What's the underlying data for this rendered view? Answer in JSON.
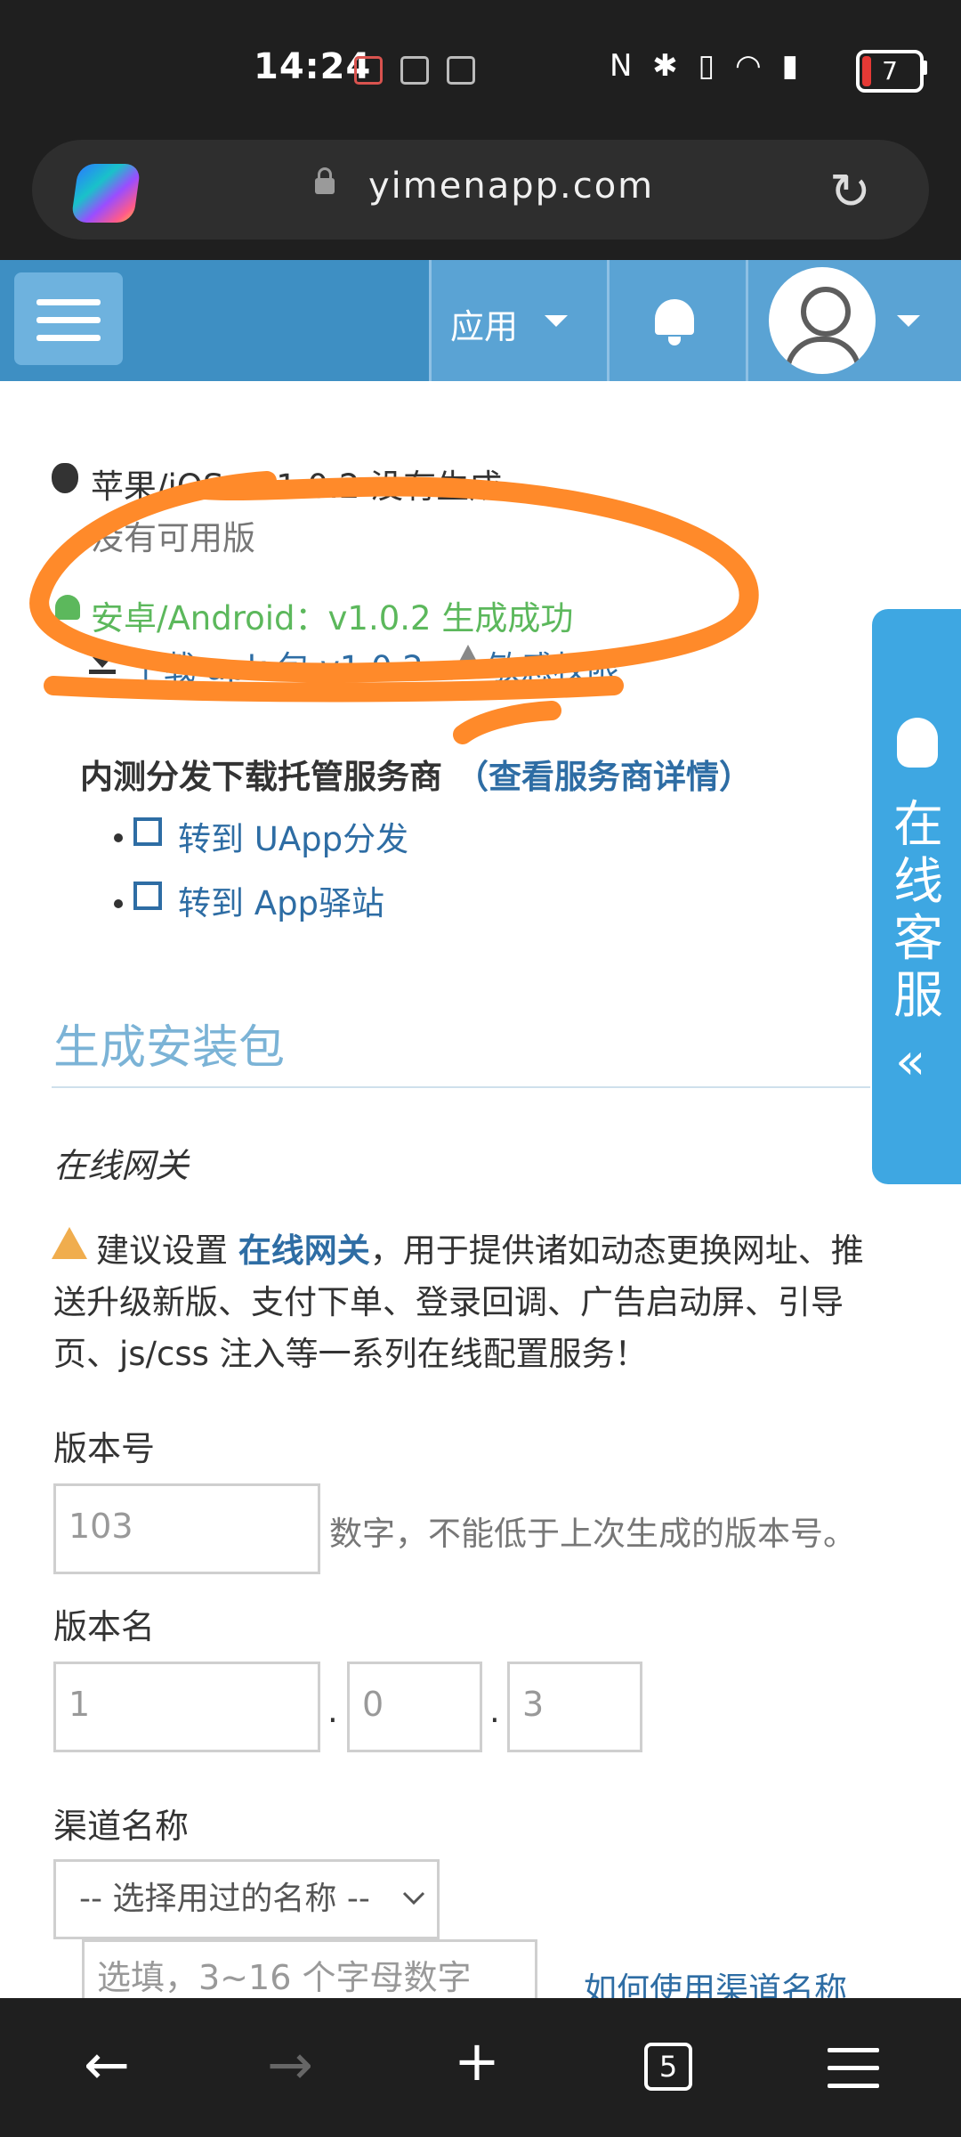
{
  "status_bar": {
    "time": "14:24",
    "battery": "7"
  },
  "browser": {
    "url": "yimenapp.com"
  },
  "navbar": {
    "apps_menu": "应用"
  },
  "ios": {
    "label": "苹果/iOS：v1.0.2 没有生成",
    "sub": "没有可用版"
  },
  "android": {
    "label": "安卓/Android：v1.0.2 生成成功",
    "download": "下载 apk 包 v1.0.2",
    "permissions": "敏感权限"
  },
  "hosting": {
    "title": "内测分发下载托管服务商",
    "detail_link": "（查看服务商详情）",
    "items": [
      "转到 UApp分发",
      "转到 App驿站"
    ]
  },
  "section": {
    "title": "生成安装包",
    "subheading": "在线网关"
  },
  "notice": {
    "prefix": "建议设置 ",
    "link": "在线网关",
    "line1_rest": "，用于提供诸如动态更换网址、推",
    "line2": "送升级新版、支付下单、登录回调、广告启动屏、引导",
    "line3": "页、js/css 注入等一系列在线配置服务！"
  },
  "form": {
    "version_code_label": "版本号",
    "version_code_value": "103",
    "version_code_hint": "数字，不能低于上次生成的版本号。",
    "version_name_label": "版本名",
    "version_name_parts": [
      "1",
      "0",
      "3"
    ],
    "dot": ".",
    "channel_label": "渠道名称",
    "channel_select": "-- 选择用过的名称 --",
    "channel_placeholder": "选填，3~16 个字母数字",
    "channel_help": "如何使用渠道名称"
  },
  "cs_tab": {
    "text": "在线客服"
  },
  "bottom_bar": {
    "tabs": "5"
  },
  "colors": {
    "navbar": "#3e8fc3",
    "link": "#2e6da4",
    "success": "#5cb85c",
    "annotation": "#ff8a2a",
    "cs_tab": "#3ea7e2"
  }
}
